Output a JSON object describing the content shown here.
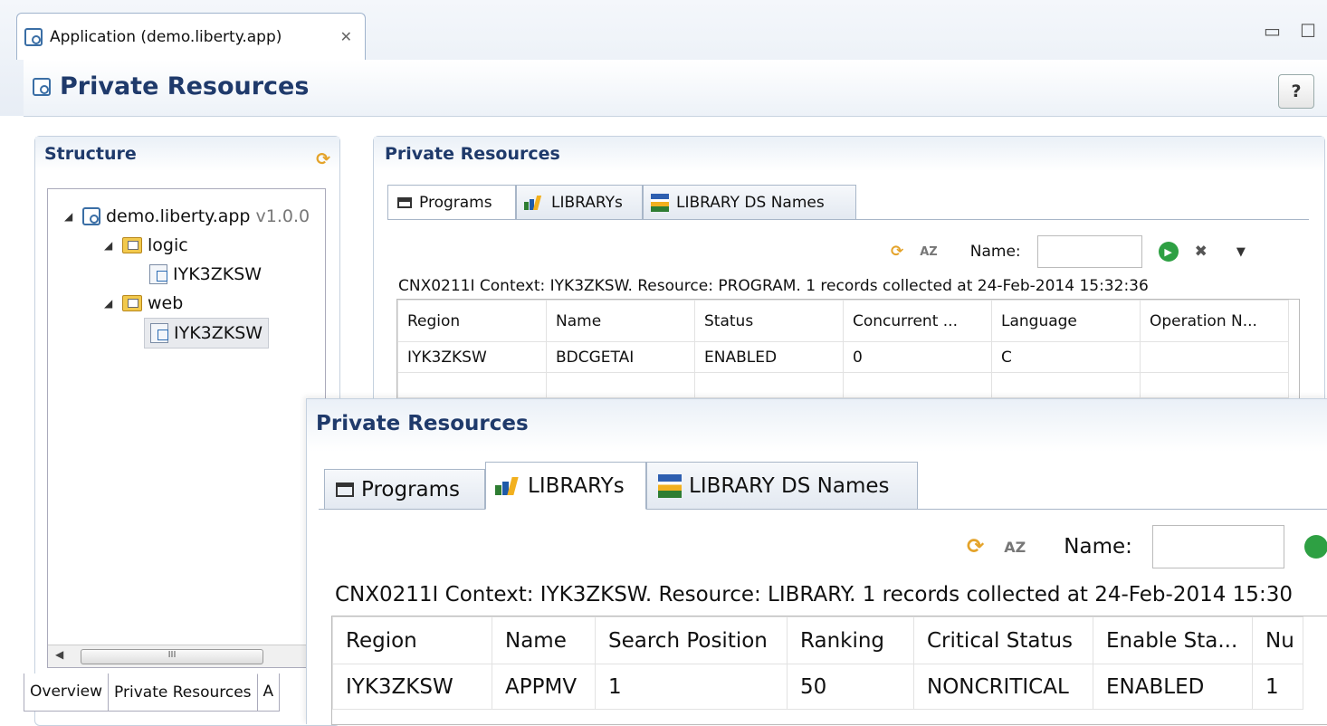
{
  "editor_tab": {
    "title": "Application (demo.liberty.app)",
    "close_glyph": "✕"
  },
  "form": {
    "title": "Private Resources",
    "help": "?"
  },
  "structure": {
    "title": "Structure",
    "tree": [
      {
        "label": "demo.liberty.app",
        "version": "v1.0.0",
        "level": 0
      },
      {
        "label": "logic",
        "level": 1
      },
      {
        "label": "IYK3ZKSW",
        "level": 2
      },
      {
        "label": "web",
        "level": 1
      },
      {
        "label": "IYK3ZKSW",
        "level": 2,
        "selected": true
      }
    ],
    "scroll_grip": "III",
    "bottom_tabs": [
      "Overview",
      "Private Resources",
      "A"
    ]
  },
  "back_panel": {
    "title": "Private Resources",
    "tabs": [
      "Programs",
      "LIBRARYs",
      "LIBRARY DS Names"
    ],
    "name_label": "Name:",
    "status": "CNX0211I Context: IYK3ZKSW. Resource: PROGRAM. 1 records collected at 24-Feb-2014 15:32:36",
    "columns": [
      "Region",
      "Name",
      "Status",
      "Concurrent ...",
      "Language",
      "Operation N..."
    ],
    "rows": [
      [
        "IYK3ZKSW",
        "BDCGETAI",
        "ENABLED",
        "0",
        "C",
        ""
      ]
    ]
  },
  "front_panel": {
    "title": "Private Resources",
    "tabs": [
      "Programs",
      "LIBRARYs",
      "LIBRARY DS Names"
    ],
    "name_label": "Name:",
    "status": "CNX0211I Context: IYK3ZKSW. Resource: LIBRARY. 1 records collected at 24-Feb-2014 15:30",
    "columns": [
      "Region",
      "Name",
      "Search Position",
      "Ranking",
      "Critical Status",
      "Enable Sta...",
      "Nu"
    ],
    "rows": [
      [
        "IYK3ZKSW",
        "APPMV",
        "1",
        "50",
        "NONCRITICAL",
        "ENABLED",
        "1"
      ]
    ]
  },
  "colors": {
    "title": "#1f3a6b",
    "accent": "#3a6ea5"
  }
}
